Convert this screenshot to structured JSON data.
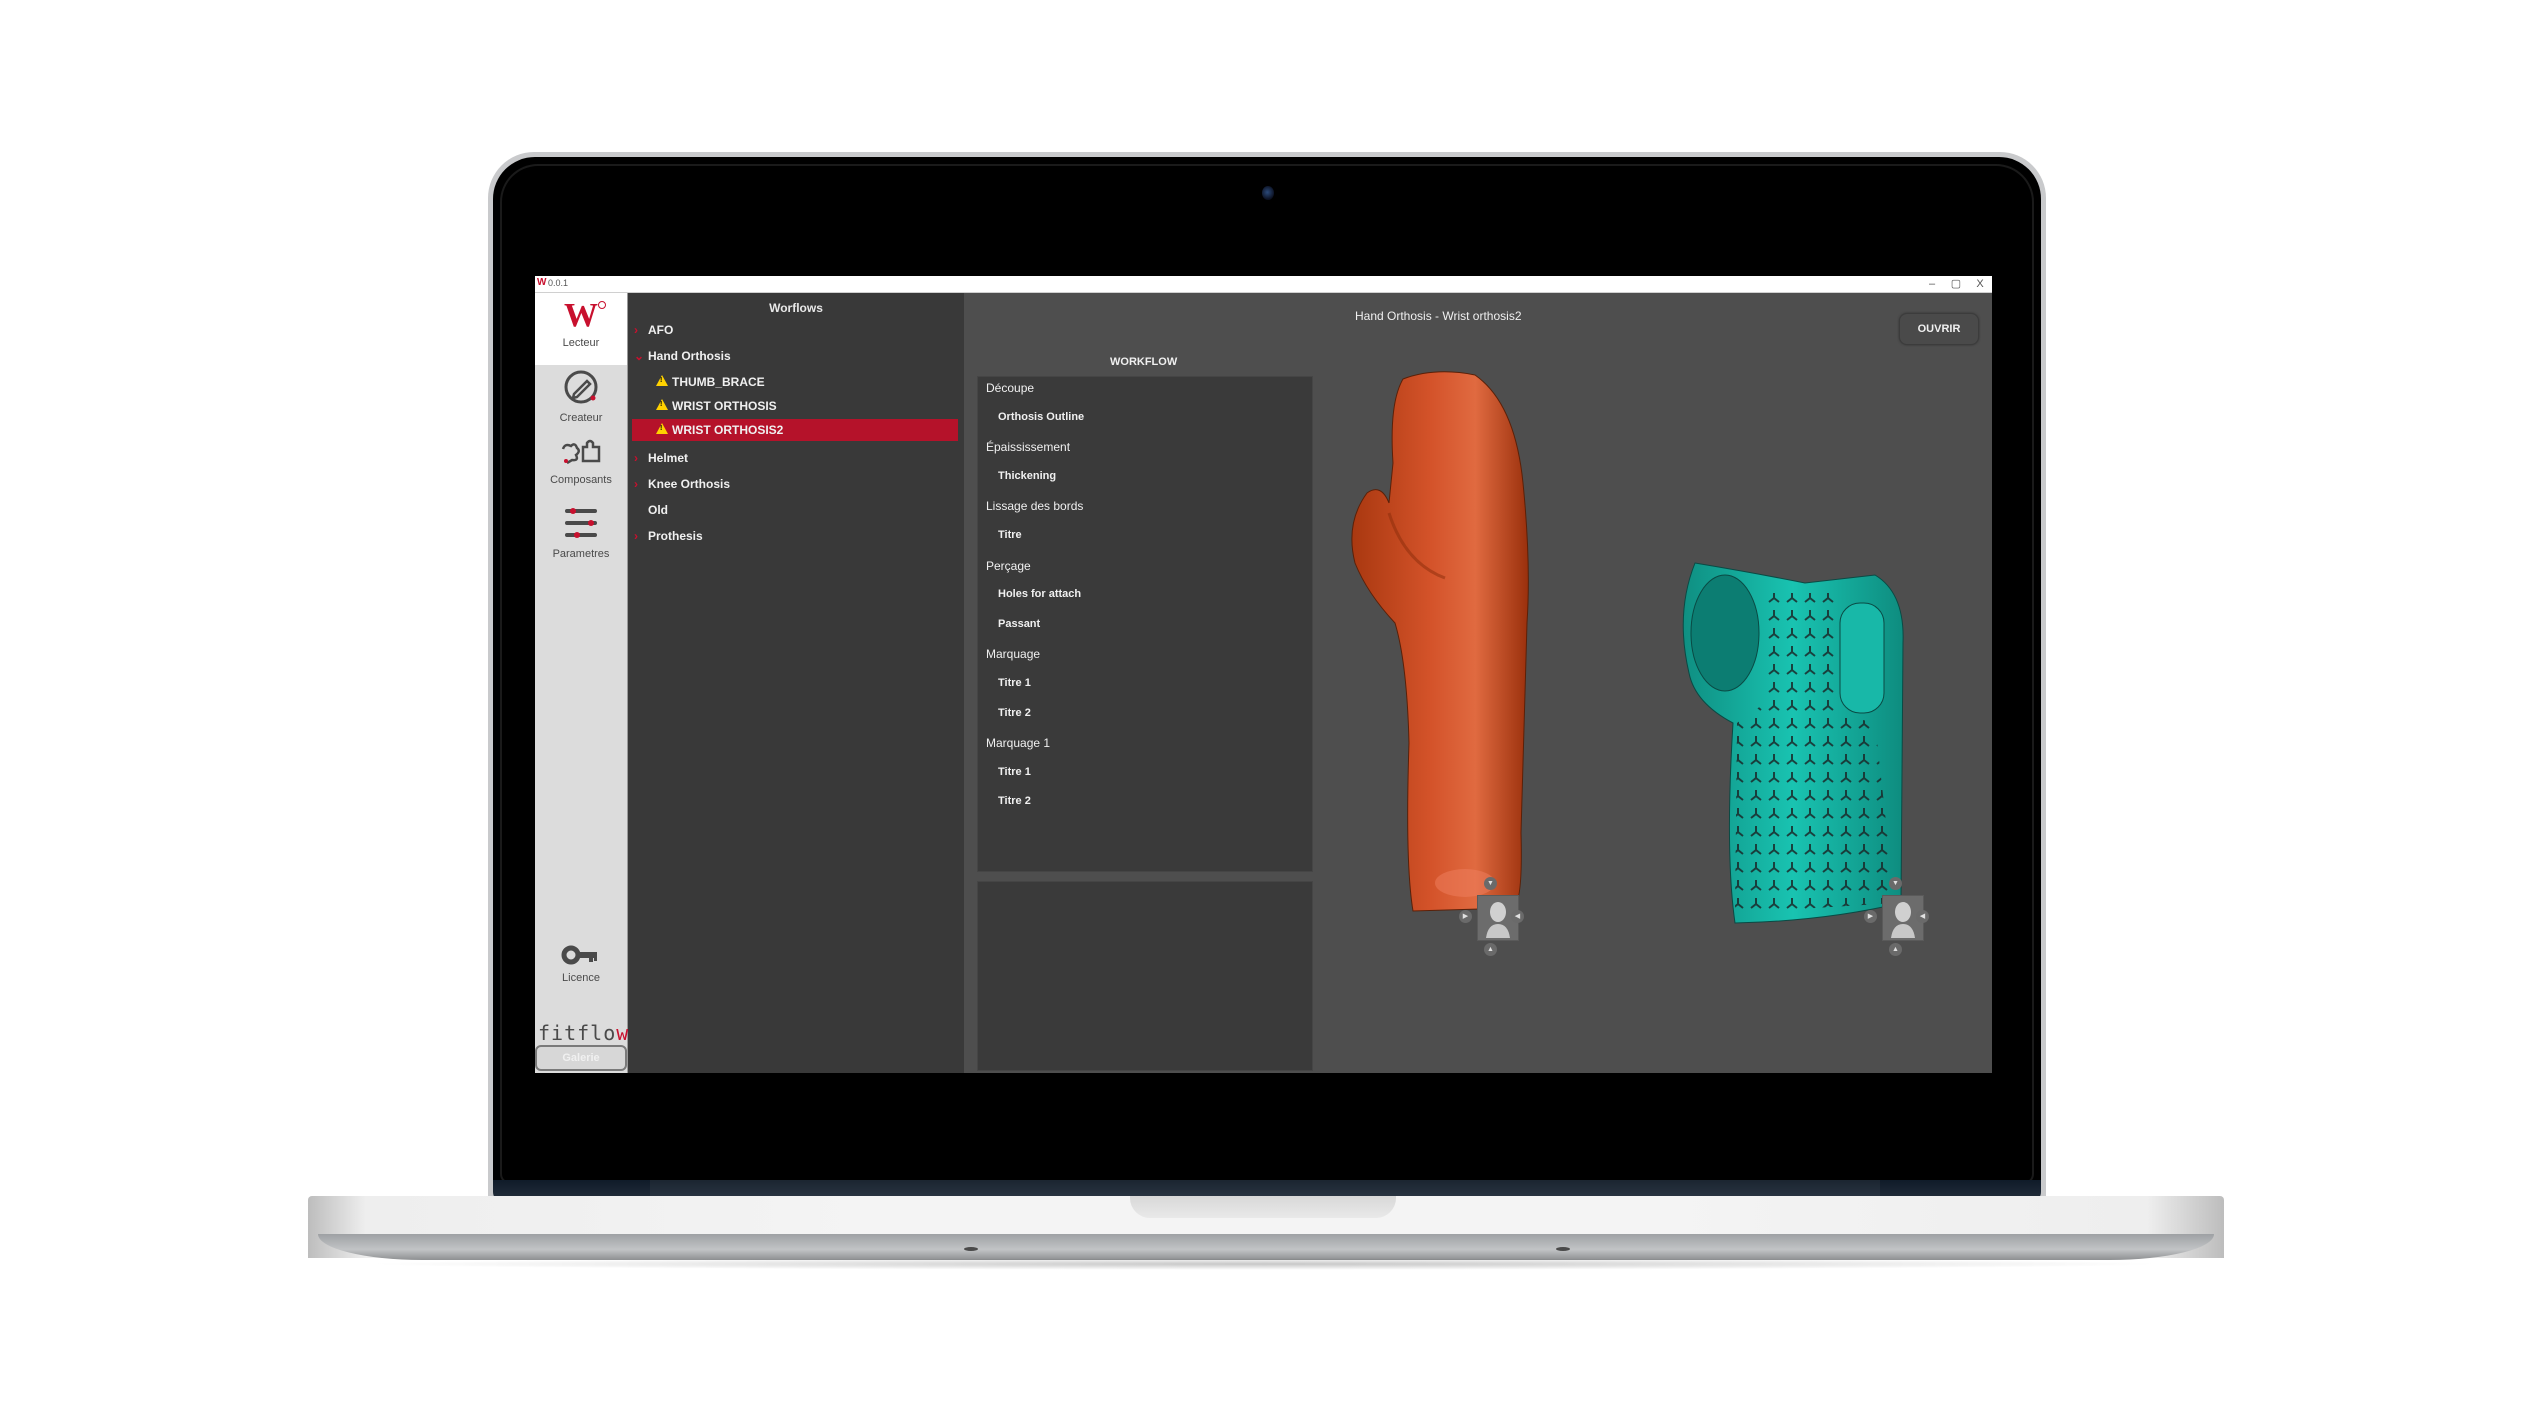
{
  "window": {
    "version": "0.0.1",
    "controls": {
      "minimize": "–",
      "maximize": "▢",
      "close": "X"
    }
  },
  "sidebar": {
    "items": [
      {
        "label": "Lecteur",
        "icon": "w-logo-icon",
        "active": true
      },
      {
        "label": "Createur",
        "icon": "pencil-dial-icon",
        "active": false
      },
      {
        "label": "Composants",
        "icon": "puzzle-icon",
        "active": false
      },
      {
        "label": "Parametres",
        "icon": "sliders-icon",
        "active": false
      }
    ],
    "licence_label": "Licence",
    "brand": {
      "prefix": "fitflo",
      "suffix": "w"
    },
    "galerie_label": "Galerie"
  },
  "workflows": {
    "title": "Worflows",
    "items": [
      {
        "label": "AFO",
        "expanded": false
      },
      {
        "label": "Hand Orthosis",
        "expanded": true
      },
      {
        "label": "THUMB_BRACE",
        "child": true,
        "warning": true
      },
      {
        "label": "WRIST ORTHOSIS",
        "child": true,
        "warning": true
      },
      {
        "label": "WRIST ORTHOSIS2",
        "child": true,
        "warning": true,
        "selected": true
      },
      {
        "label": "Helmet",
        "expanded": false
      },
      {
        "label": "Knee Orthosis",
        "expanded": false
      },
      {
        "label": "Old",
        "leaf": true
      },
      {
        "label": "Prothesis",
        "expanded": false
      }
    ]
  },
  "main": {
    "title": "Hand Orthosis - Wrist orthosis2",
    "open_button": "OUVRIR",
    "workflow_title": "WORKFLOW",
    "steps": [
      {
        "label": "Découpe",
        "type": "section"
      },
      {
        "label": "Orthosis Outline",
        "type": "step"
      },
      {
        "label": "Épaississement",
        "type": "section"
      },
      {
        "label": "Thickening",
        "type": "step"
      },
      {
        "label": "Lissage des bords",
        "type": "section"
      },
      {
        "label": "Titre",
        "type": "step"
      },
      {
        "label": "Perçage",
        "type": "section"
      },
      {
        "label": "Holes for attach",
        "type": "step"
      },
      {
        "label": "Passant",
        "type": "step"
      },
      {
        "label": "Marquage",
        "type": "section"
      },
      {
        "label": "Titre 1",
        "type": "step"
      },
      {
        "label": "Titre 2",
        "type": "step"
      },
      {
        "label": "Marquage 1",
        "type": "section"
      },
      {
        "label": "Titre 1",
        "type": "step"
      },
      {
        "label": "Titre 2",
        "type": "step"
      }
    ]
  },
  "viewport": {
    "models": [
      {
        "name": "hand-scan",
        "color": "#c8441d"
      },
      {
        "name": "wrist-orthosis",
        "color": "#13b3a3"
      }
    ],
    "nav_arrows": {
      "up": "▼",
      "down": "▲",
      "left": "▶",
      "right": "◀"
    }
  },
  "colors": {
    "accent": "#c8102e",
    "selected": "#b5122a",
    "warning": "#ffd200"
  }
}
